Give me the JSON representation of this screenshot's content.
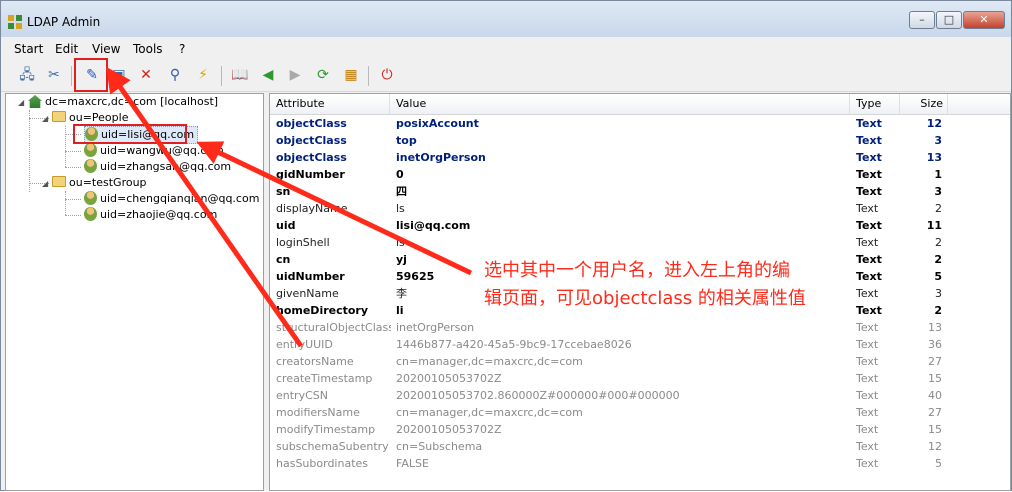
{
  "window": {
    "title": "LDAP Admin",
    "controls": {
      "minimize": "–",
      "maximize": "□",
      "close": "✕"
    }
  },
  "menu": {
    "items": [
      {
        "id": "start",
        "label": "Start"
      },
      {
        "id": "edit",
        "label": "Edit"
      },
      {
        "id": "view",
        "label": "View"
      },
      {
        "id": "tools",
        "label": "Tools"
      },
      {
        "id": "help",
        "label": "?"
      }
    ]
  },
  "toolbar": {
    "buttons": [
      {
        "name": "connect-icon",
        "glyph": "🖧"
      },
      {
        "name": "disconnect-icon",
        "glyph": "✂"
      },
      {
        "name": "edit-entry-icon",
        "glyph": "✎"
      },
      {
        "name": "save-icon",
        "glyph": "▣"
      },
      {
        "name": "delete-icon",
        "glyph": "✕"
      },
      {
        "name": "search-icon",
        "glyph": "⚲"
      },
      {
        "name": "lightning-icon",
        "glyph": "⚡"
      },
      {
        "name": "book-icon",
        "glyph": "📖"
      },
      {
        "name": "back-icon",
        "glyph": "◀"
      },
      {
        "name": "forward-icon",
        "glyph": "▶"
      },
      {
        "name": "refresh-icon",
        "glyph": "⟳"
      },
      {
        "name": "schema-icon",
        "glyph": "▦"
      },
      {
        "name": "stop-icon",
        "glyph": "⏻"
      }
    ]
  },
  "tree": {
    "root": "dc=maxcrc,dc=com [localhost]",
    "people": "ou=People",
    "people_users": [
      "uid=lisi@qq.com",
      "uid=wangwu@qq.com",
      "uid=zhangsan@qq.com"
    ],
    "group": "ou=testGroup",
    "group_users": [
      "uid=chengqianqian@qq.com",
      "uid=zhaojie@qq.com"
    ]
  },
  "grid": {
    "headers": {
      "attribute": "Attribute",
      "value": "Value",
      "type": "Type",
      "size": "Size"
    },
    "rows": [
      {
        "attribute": "objectClass",
        "value": "posixAccount",
        "type": "Text",
        "size": "12",
        "style": "must"
      },
      {
        "attribute": "objectClass",
        "value": "top",
        "type": "Text",
        "size": "3",
        "style": "must"
      },
      {
        "attribute": "objectClass",
        "value": "inetOrgPerson",
        "type": "Text",
        "size": "13",
        "style": "must"
      },
      {
        "attribute": "gidNumber",
        "value": "0",
        "type": "Text",
        "size": "1",
        "style": "bold"
      },
      {
        "attribute": "sn",
        "value": "四",
        "type": "Text",
        "size": "3",
        "style": "bold"
      },
      {
        "attribute": "displayName",
        "value": "ls",
        "type": "Text",
        "size": "2",
        "style": "norm"
      },
      {
        "attribute": "uid",
        "value": "lisi@qq.com",
        "type": "Text",
        "size": "11",
        "style": "bold"
      },
      {
        "attribute": "loginShell",
        "value": "ls",
        "type": "Text",
        "size": "2",
        "style": "norm"
      },
      {
        "attribute": "cn",
        "value": "yj",
        "type": "Text",
        "size": "2",
        "style": "bold"
      },
      {
        "attribute": "uidNumber",
        "value": "59625",
        "type": "Text",
        "size": "5",
        "style": "bold"
      },
      {
        "attribute": "givenName",
        "value": "李",
        "type": "Text",
        "size": "3",
        "style": "norm"
      },
      {
        "attribute": "homeDirectory",
        "value": "li",
        "type": "Text",
        "size": "2",
        "style": "bold"
      },
      {
        "attribute": "structuralObjectClass",
        "value": "inetOrgPerson",
        "type": "Text",
        "size": "13",
        "style": "op"
      },
      {
        "attribute": "entryUUID",
        "value": "1446b877-a420-45a5-9bc9-17ccebae8026",
        "type": "Text",
        "size": "36",
        "style": "op"
      },
      {
        "attribute": "creatorsName",
        "value": "cn=manager,dc=maxcrc,dc=com",
        "type": "Text",
        "size": "27",
        "style": "op"
      },
      {
        "attribute": "createTimestamp",
        "value": "20200105053702Z",
        "type": "Text",
        "size": "15",
        "style": "op"
      },
      {
        "attribute": "entryCSN",
        "value": "20200105053702.860000Z#000000#000#000000",
        "type": "Text",
        "size": "40",
        "style": "op"
      },
      {
        "attribute": "modifiersName",
        "value": "cn=manager,dc=maxcrc,dc=com",
        "type": "Text",
        "size": "27",
        "style": "op"
      },
      {
        "attribute": "modifyTimestamp",
        "value": "20200105053702Z",
        "type": "Text",
        "size": "15",
        "style": "op"
      },
      {
        "attribute": "subschemaSubentry",
        "value": "cn=Subschema",
        "type": "Text",
        "size": "12",
        "style": "op"
      },
      {
        "attribute": "hasSubordinates",
        "value": "FALSE",
        "type": "Text",
        "size": "5",
        "style": "op"
      }
    ]
  },
  "annotation": {
    "line1": "选中其中一个用户名，进入左上角的编",
    "line2": "辑页面，可见objectclass 的相关属性值"
  },
  "colors": {
    "highlight": "#e02020",
    "annotation": "#ff2a1a",
    "must_attr": "#001f7a",
    "operational": "#8a8a8a"
  }
}
